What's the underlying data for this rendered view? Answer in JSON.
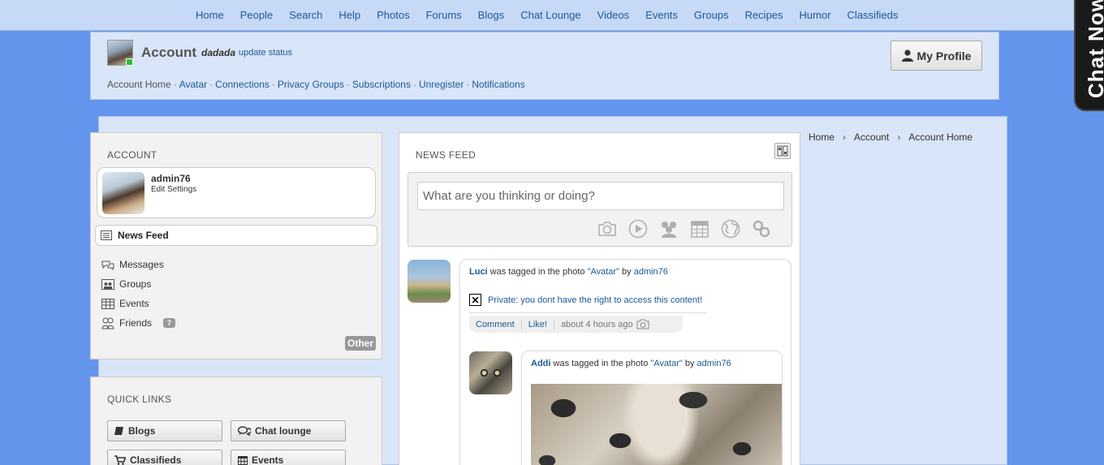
{
  "nav": [
    "Home",
    "People",
    "Search",
    "Help",
    "Photos",
    "Forums",
    "Blogs",
    "Chat Lounge",
    "Videos",
    "Events",
    "Groups",
    "Recipes",
    "Humor",
    "Classifieds"
  ],
  "chat_tab": "Chat Now",
  "account_header": {
    "title": "Account",
    "status": "dadada",
    "update_status": "update status",
    "links": [
      "Account Home",
      "Avatar",
      "Connections",
      "Privacy Groups",
      "Subscriptions",
      "Unregister",
      "Notifications"
    ],
    "my_profile": "My Profile"
  },
  "account_panel": {
    "heading": "ACCOUNT",
    "username": "admin76",
    "edit_settings": "Edit Settings",
    "news_feed": "News Feed",
    "menu": [
      {
        "label": "Messages",
        "icon": "messages-icon"
      },
      {
        "label": "Groups",
        "icon": "groups-icon"
      },
      {
        "label": "Events",
        "icon": "events-icon"
      },
      {
        "label": "Friends",
        "icon": "friends-icon",
        "badge": "7"
      }
    ],
    "other": "Other"
  },
  "quick_links": {
    "heading": "QUICK LINKS",
    "items": [
      "Blogs",
      "Chat lounge",
      "Classifieds",
      "Events"
    ]
  },
  "news_feed": {
    "heading": "NEWS FEED",
    "placeholder": "What are you thinking or doing?",
    "entries": [
      {
        "user": "Luci",
        "text_mid": " was tagged in the photo ",
        "photo": "\"Avatar\"",
        "by": " by ",
        "author": "admin76",
        "private_msg": "Private: you dont have the right to access this content!",
        "actions": [
          "Comment",
          "Like!"
        ],
        "time": "about 4 hours ago"
      },
      {
        "user": "Addi",
        "text_mid": " was tagged in the photo ",
        "photo": "\"Avatar\"",
        "by": " by ",
        "author": "admin76"
      }
    ]
  },
  "breadcrumbs": [
    "Home",
    "Account",
    "Account Home"
  ],
  "colors": {
    "background": "#6495ed",
    "link": "#1a5a96",
    "panel": "#d9e5f8"
  }
}
